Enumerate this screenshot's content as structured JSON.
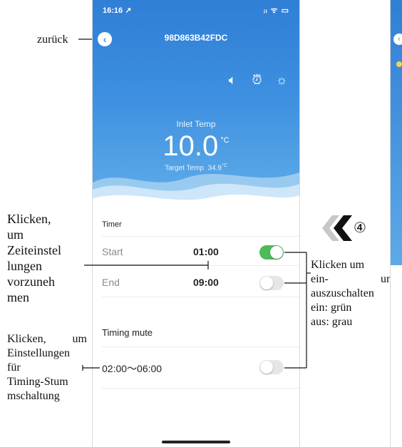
{
  "annotations": {
    "back": "zurück",
    "time_setting": "Klicken, um Zeiteinstel lungen vorzuneh men",
    "time_setting_lines": [
      "Klicken,",
      "um",
      "Zeiteinstel",
      "lungen",
      "vorzuneh",
      "men"
    ],
    "mute_setting_lines": [
      "Klicken, um",
      "Einstellungen",
      "für",
      "Timing-Stum",
      "mschaltung"
    ],
    "toggle_lines": [
      "Klicken um",
      "ein- und",
      "auszuschalten",
      "ein: grün",
      "aus: grau"
    ],
    "step_number": "④"
  },
  "status_bar": {
    "time": "16:16 ↗",
    "icons": "ᵢₗ ᯤ ▭"
  },
  "header": {
    "back_icon": "‹",
    "title": "98D863B42FDC"
  },
  "hero": {
    "icons": [
      "mute-icon",
      "alarm-icon",
      "sun-icon"
    ],
    "icon_glyphs": [
      "🔈︎",
      "⏰︎",
      "☼"
    ],
    "inlet_label": "Inlet Temp",
    "inlet_value": "10.0",
    "inlet_unit": "°C",
    "target_label": "Target Temp",
    "target_value": "34.9",
    "target_unit": "°C"
  },
  "timer": {
    "title": "Timer",
    "start_label": "Start",
    "start_time": "01:00",
    "start_enabled": true,
    "end_label": "End",
    "end_time": "09:00",
    "end_enabled": false
  },
  "timing_mute": {
    "title": "Timing mute",
    "range": "02:00～06:00",
    "enabled": false
  },
  "colors": {
    "hero_top": "#2f7fd6",
    "toggle_on": "#4cbb5a",
    "toggle_off": "#e6e6e6"
  }
}
